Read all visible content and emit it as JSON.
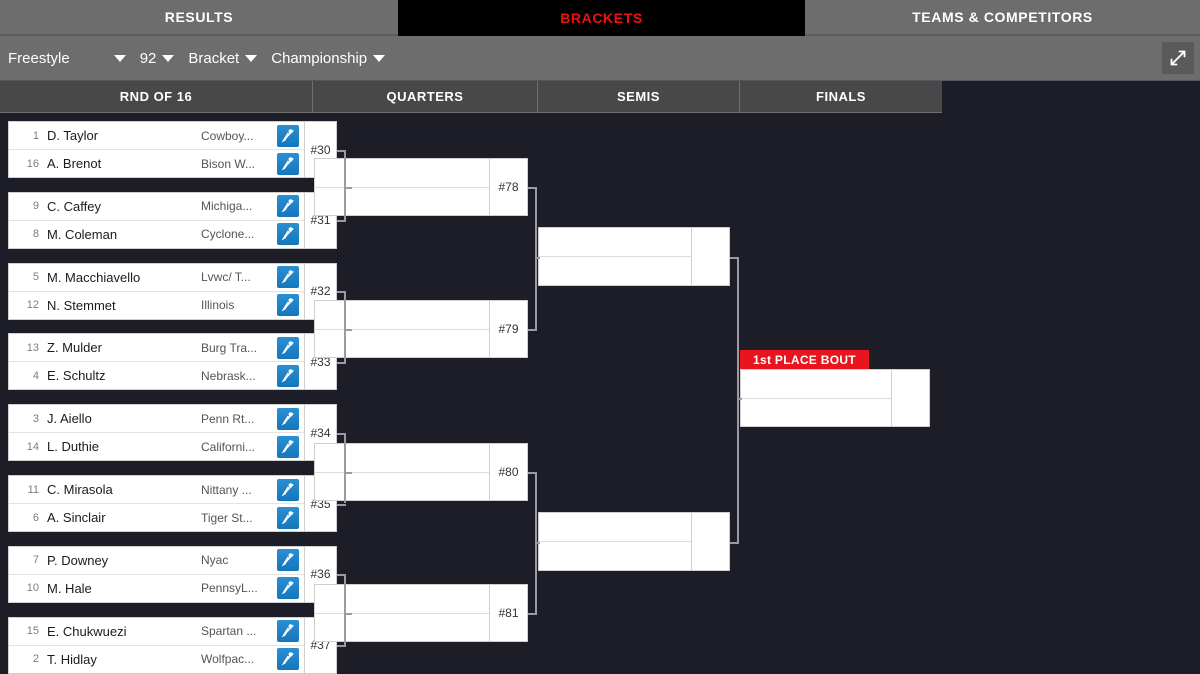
{
  "nav": {
    "tabs": [
      {
        "label": "RESULTS",
        "active": false
      },
      {
        "label": "BRACKETS",
        "active": true
      },
      {
        "label": "TEAMS & COMPETITORS",
        "active": false
      }
    ]
  },
  "filters": {
    "style": "Freestyle",
    "weight": "92",
    "view": "Bracket",
    "division": "Championship",
    "expand_icon": "expand-arrows-icon"
  },
  "rounds": [
    {
      "label": "RND OF 16"
    },
    {
      "label": "QUARTERS"
    },
    {
      "label": "SEMIS"
    },
    {
      "label": "FINALS"
    }
  ],
  "round_of_16": [
    {
      "bout": "#30",
      "wrestlers": [
        {
          "seed": "1",
          "name": "D. Taylor",
          "team": "Cowboy...",
          "icon": "wrestler-icon"
        },
        {
          "seed": "16",
          "name": "A. Brenot",
          "team": "Bison W...",
          "icon": "wrestler-icon"
        }
      ]
    },
    {
      "bout": "#31",
      "wrestlers": [
        {
          "seed": "9",
          "name": "C. Caffey",
          "team": "Michiga...",
          "icon": "wrestler-icon"
        },
        {
          "seed": "8",
          "name": "M. Coleman",
          "team": "Cyclone...",
          "icon": "wrestler-icon"
        }
      ]
    },
    {
      "bout": "#32",
      "wrestlers": [
        {
          "seed": "5",
          "name": "M. Macchiavello",
          "team": "Lvwc/ T...",
          "icon": "wrestler-icon"
        },
        {
          "seed": "12",
          "name": "N. Stemmet",
          "team": "Illinois",
          "icon": "wrestler-icon"
        }
      ]
    },
    {
      "bout": "#33",
      "wrestlers": [
        {
          "seed": "13",
          "name": "Z. Mulder",
          "team": "Burg Tra...",
          "icon": "wrestler-icon"
        },
        {
          "seed": "4",
          "name": "E. Schultz",
          "team": "Nebrask...",
          "icon": "wrestler-icon"
        }
      ]
    },
    {
      "bout": "#34",
      "wrestlers": [
        {
          "seed": "3",
          "name": "J. Aiello",
          "team": "Penn Rt...",
          "icon": "wrestler-icon"
        },
        {
          "seed": "14",
          "name": "L. Duthie",
          "team": "Californi...",
          "icon": "wrestler-icon"
        }
      ]
    },
    {
      "bout": "#35",
      "wrestlers": [
        {
          "seed": "11",
          "name": "C. Mirasola",
          "team": "Nittany ...",
          "icon": "wrestler-icon"
        },
        {
          "seed": "6",
          "name": "A. Sinclair",
          "team": "Tiger St...",
          "icon": "wrestler-icon"
        }
      ]
    },
    {
      "bout": "#36",
      "wrestlers": [
        {
          "seed": "7",
          "name": "P. Downey",
          "team": "Nyac",
          "icon": "wrestler-icon"
        },
        {
          "seed": "10",
          "name": "M. Hale",
          "team": "PennsyL...",
          "icon": "wrestler-icon"
        }
      ]
    },
    {
      "bout": "#37",
      "wrestlers": [
        {
          "seed": "15",
          "name": "E. Chukwuezi",
          "team": "Spartan ...",
          "icon": "wrestler-icon"
        },
        {
          "seed": "2",
          "name": "T. Hidlay",
          "team": "Wolfpac...",
          "icon": "wrestler-icon"
        }
      ]
    }
  ],
  "quarters": [
    {
      "bout": "#78",
      "wrestlers": [
        "",
        ""
      ]
    },
    {
      "bout": "#79",
      "wrestlers": [
        "",
        ""
      ]
    },
    {
      "bout": "#80",
      "wrestlers": [
        "",
        ""
      ]
    },
    {
      "bout": "#81",
      "wrestlers": [
        "",
        ""
      ]
    }
  ],
  "semis": [
    {
      "bout": "",
      "wrestlers": [
        "",
        ""
      ]
    },
    {
      "bout": "",
      "wrestlers": [
        "",
        ""
      ]
    }
  ],
  "finals": {
    "badge": "1st PLACE BOUT",
    "bout": "",
    "wrestlers": [
      "",
      ""
    ]
  },
  "colors": {
    "accent_red": "#e8151f",
    "tab_active_text": "#ee1111",
    "background": "#1d1d27",
    "chrome_gray": "#6d6d6d",
    "header_gray": "#484848",
    "icon_blue": "#1576bb"
  }
}
